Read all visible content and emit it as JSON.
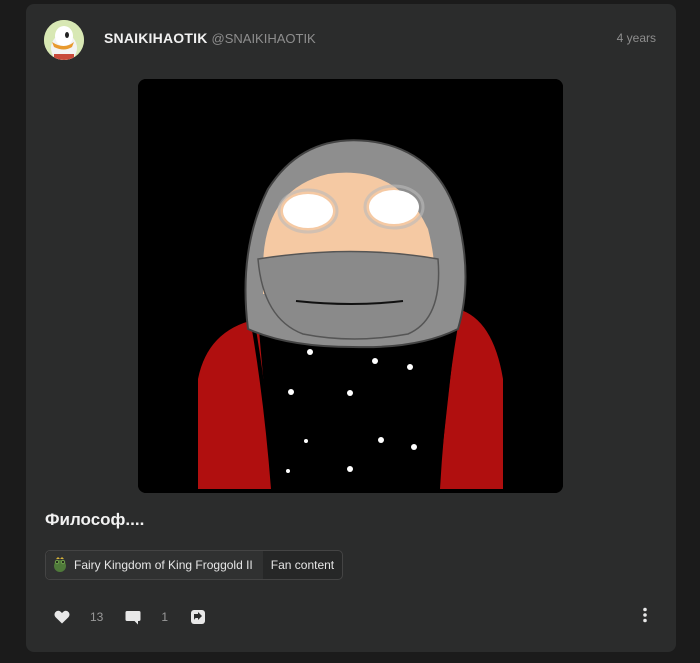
{
  "post": {
    "author": {
      "display_name": "SNAIKIHAOTIK",
      "handle": "@SNAIKIHAOTIK"
    },
    "timestamp": "4 years",
    "title": "Философ....",
    "tags": {
      "community": "Fairy Kingdom of King Froggold II",
      "flair": "Fan content"
    },
    "stats": {
      "likes": "13",
      "comments": "1"
    }
  },
  "icons": {
    "like": "heart-icon",
    "comment": "comment-icon",
    "share": "share-icon",
    "more": "more-vertical-icon"
  },
  "colors": {
    "background": "#1b1b1b",
    "card": "#2b2c2c",
    "text": "#e6e6e6",
    "muted": "#8e8e8e"
  }
}
